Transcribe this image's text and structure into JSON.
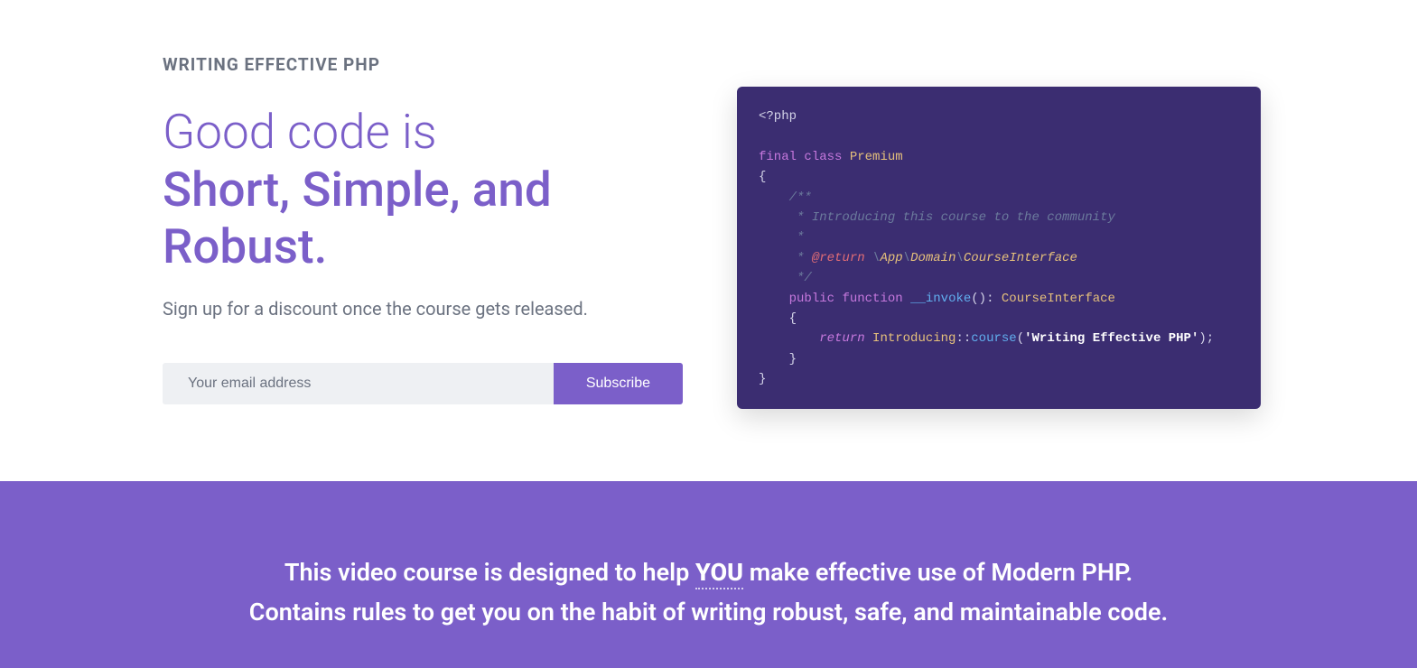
{
  "hero": {
    "eyebrow": "WRITING EFFECTIVE PHP",
    "headline_light": "Good code is",
    "headline_bold": "Short, Simple, and Robust.",
    "subtext": "Sign up for a discount once the course gets released.",
    "email_placeholder": "Your email address",
    "subscribe_label": "Subscribe"
  },
  "code": {
    "open_tag": "<?php",
    "kw_final": "final",
    "kw_class": "class",
    "class_name": "Premium",
    "brace_open": "{",
    "doc_open": "/**",
    "doc_line1": " * Introducing this course to the community",
    "doc_empty": " *",
    "doc_return_prefix": " * ",
    "doc_return_ann": "@return",
    "doc_return_sep1": " \\",
    "doc_return_ns1": "App",
    "doc_return_sep2": "\\",
    "doc_return_ns2": "Domain",
    "doc_return_sep3": "\\",
    "doc_return_ns3": "CourseInterface",
    "doc_close": " */",
    "kw_public": "public",
    "kw_function": "function",
    "fn_name": "__invoke",
    "fn_parens": "()",
    "fn_colon": ": ",
    "fn_rettype": "CourseInterface",
    "inner_brace_open": "{",
    "kw_return": "return",
    "call_class": "Introducing",
    "scope": "::",
    "call_method": "course",
    "call_open": "(",
    "str_quote_open": "'",
    "str_value": "Writing Effective PHP",
    "str_quote_close": "'",
    "call_close": ");",
    "inner_brace_close": "}",
    "brace_close": "}"
  },
  "banner": {
    "line1_pre": "This video course is designed to help ",
    "line1_you": "YOU",
    "line1_post": " make effective use of Modern PHP.",
    "line2": "Contains rules to get you on the habit of writing robust, safe, and maintainable code."
  }
}
